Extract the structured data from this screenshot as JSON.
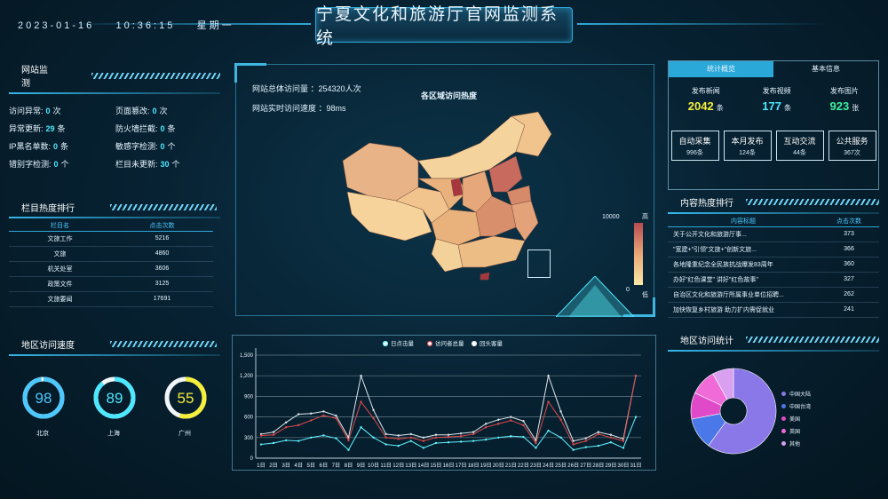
{
  "header": {
    "date": "2023-01-16",
    "time": "10:36:15",
    "weekday": "星期一",
    "title": "宁夏文化和旅游厅官网监测系统"
  },
  "site_monitor": {
    "title": "网站监测",
    "items": [
      {
        "label": "访问异常:",
        "value": "0",
        "unit": "次"
      },
      {
        "label": "页面篡改:",
        "value": "0",
        "unit": "次"
      },
      {
        "label": "异常更新:",
        "value": "29",
        "unit": "条"
      },
      {
        "label": "防火墙拦截:",
        "value": "0",
        "unit": "条"
      },
      {
        "label": "IP黑名单数:",
        "value": "0",
        "unit": "条"
      },
      {
        "label": "敏感字检测:",
        "value": "0",
        "unit": "个"
      },
      {
        "label": "错别字检测:",
        "value": "0",
        "unit": "个"
      },
      {
        "label": "栏目未更新:",
        "value": "30",
        "unit": "个"
      }
    ]
  },
  "column_rank": {
    "title": "栏目热度排行",
    "headers": [
      "栏目名",
      "点击次数"
    ],
    "rows": [
      [
        "文旅工作",
        "5216"
      ],
      [
        "文旅",
        "4860"
      ],
      [
        "机关处室",
        "3606"
      ],
      [
        "政策文件",
        "3125"
      ],
      [
        "文旅要闻",
        "17691"
      ]
    ]
  },
  "region_speed": {
    "title": "地区访问速度",
    "gauges": [
      {
        "city": "北京",
        "value": 98,
        "color": "#4dc8ff"
      },
      {
        "city": "上海",
        "value": 89,
        "color": "#4de8ff"
      },
      {
        "city": "广州",
        "value": 55,
        "color": "#f4ef3a"
      }
    ]
  },
  "map_panel": {
    "total_label": "网站总体访问量",
    "total_value": "：254320人次",
    "speed_label": "网站实时访问速度",
    "speed_value": "：98ms",
    "map_title": "各区域访问热度",
    "scale_max": "10000",
    "scale_min": "0",
    "scale_high": "高",
    "scale_low": "低",
    "colors": {
      "low": "#fbe8a6",
      "mid": "#e8a878",
      "high": "#b84a50"
    }
  },
  "stats": {
    "tabs": [
      "统计概览",
      "基本信息"
    ],
    "counters": [
      {
        "label": "发布新闻",
        "value": "2042",
        "unit": "条",
        "color": "#f4ef3a"
      },
      {
        "label": "发布视频",
        "value": "177",
        "unit": "条",
        "color": "#4de8ff"
      },
      {
        "label": "发布图片",
        "value": "923",
        "unit": "张",
        "color": "#3ef0a0"
      }
    ],
    "tiles": [
      {
        "label": "自动采集",
        "sub": "996条"
      },
      {
        "label": "本月发布",
        "sub": "124条"
      },
      {
        "label": "互动交流",
        "sub": "44条"
      },
      {
        "label": "公共服务",
        "sub": "367次"
      }
    ]
  },
  "content_rank": {
    "title": "内容热度排行",
    "headers": [
      "内容标题",
      "点击次数"
    ],
    "rows": [
      [
        "关于公开文化和旅游厅事...",
        "373"
      ],
      [
        "\"宽建+\"引领\"文旅+\"创新文旅...",
        "366"
      ],
      [
        "各地隆重纪念全民族抗战爆发83周年",
        "360"
      ],
      [
        "办好\"红色课堂\" 讲好\"红色故事\"",
        "327"
      ],
      [
        "自治区文化和旅游厅所属事业单位招聘...",
        "262"
      ],
      [
        "加快恢复乡村旅游 助力扩内需促就业",
        "241"
      ]
    ]
  },
  "region_stats": {
    "title": "地区访问统计",
    "slices": [
      {
        "name": "中国大陆",
        "value": 60,
        "color": "#8a78e8"
      },
      {
        "name": "中国台湾",
        "value": 12,
        "color": "#4a78e8"
      },
      {
        "name": "美国",
        "value": 10,
        "color": "#e04ac8"
      },
      {
        "name": "英国",
        "value": 10,
        "color": "#f06ad8"
      },
      {
        "name": "其他",
        "value": 8,
        "color": "#d9a0f0"
      }
    ]
  },
  "chart_data": {
    "type": "line",
    "legend": [
      "日点击量",
      "访问者总量",
      "回头客量"
    ],
    "x": [
      "1日",
      "2日",
      "3日",
      "4日",
      "5日",
      "6日",
      "7日",
      "8日",
      "9日",
      "10日",
      "11日",
      "12日",
      "13日",
      "14日",
      "15日",
      "16日",
      "17日",
      "18日",
      "19日",
      "20日",
      "21日",
      "22日",
      "23日",
      "24日",
      "25日",
      "26日",
      "27日",
      "28日",
      "29日",
      "30日",
      "31日"
    ],
    "ylim": [
      0,
      1500
    ],
    "yticks": [
      "0",
      "300",
      "600",
      "900",
      "1,200",
      "1,500"
    ],
    "series": [
      {
        "name": "日点击量",
        "color": "#5ff3ff",
        "values": [
          200,
          220,
          260,
          250,
          300,
          330,
          290,
          120,
          450,
          300,
          200,
          180,
          250,
          150,
          220,
          230,
          240,
          250,
          270,
          300,
          320,
          310,
          150,
          400,
          300,
          120,
          160,
          180,
          230,
          150,
          600
        ]
      },
      {
        "name": "访问者总量",
        "color": "#e04a4a",
        "values": [
          330,
          340,
          450,
          480,
          550,
          620,
          580,
          260,
          820,
          580,
          300,
          280,
          300,
          250,
          300,
          310,
          320,
          350,
          450,
          500,
          550,
          480,
          220,
          820,
          560,
          200,
          250,
          350,
          300,
          250,
          1200
        ]
      },
      {
        "name": "回头客量",
        "color": "#dfe8ee",
        "values": [
          350,
          380,
          520,
          640,
          650,
          680,
          620,
          300,
          1200,
          700,
          350,
          330,
          350,
          300,
          340,
          340,
          360,
          380,
          500,
          560,
          600,
          540,
          260,
          1200,
          680,
          250,
          290,
          380,
          340,
          280,
          1200
        ]
      }
    ]
  }
}
